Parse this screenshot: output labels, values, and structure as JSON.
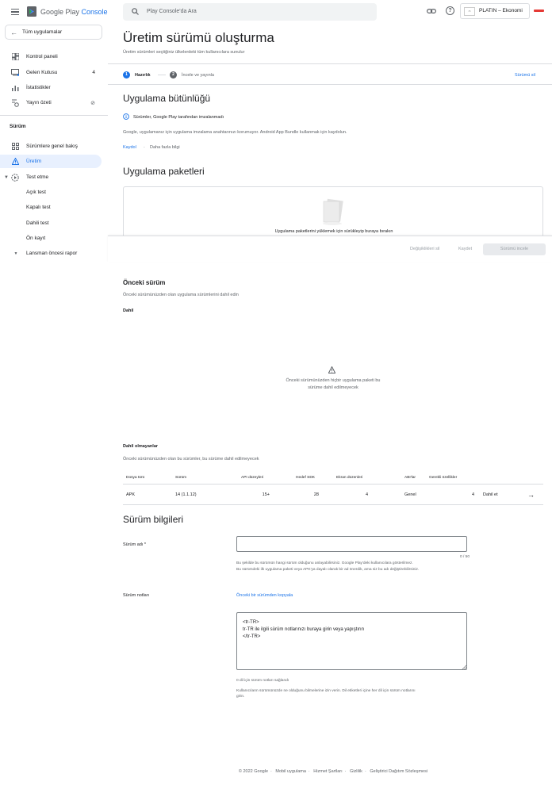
{
  "app": {
    "brand_google_play": "Google Play",
    "brand_console": "Console",
    "all_apps": "Tüm uygulamalar"
  },
  "sidebar": {
    "items": [
      {
        "label": "Kontrol paneli",
        "icon": "dashboard-icon"
      },
      {
        "label": "Gelen Kutusu",
        "icon": "inbox-icon",
        "count": "4"
      },
      {
        "label": "İstatistikler",
        "icon": "bar-chart-icon"
      },
      {
        "label": "Yayın özeti",
        "icon": "publishing-icon"
      }
    ],
    "section_title": "Sürüm",
    "release_items": [
      {
        "label": "Sürümlere genel bakış",
        "icon": "overview-icon"
      },
      {
        "label": "Üretim",
        "icon": "warning-icon",
        "active": true
      },
      {
        "label": "Test etme",
        "icon": "testing-icon"
      },
      {
        "label": "Açık test"
      },
      {
        "label": "Kapalı test"
      },
      {
        "label": "Dahili test"
      },
      {
        "label": "Ön kayıt"
      },
      {
        "label": "Lansman öncesi rapor"
      }
    ]
  },
  "topbar": {
    "search_placeholder": "Play Console'da Ara",
    "account_name": "PLATIN – Ekonomi"
  },
  "page": {
    "title": "Üretim sürümü oluşturma",
    "subtitle": "Üretim sürümleri seçtiğiniz ülkelerdeki tüm kullanıcılara sunulur",
    "steps": [
      {
        "num": "1",
        "label": "Hazırlık"
      },
      {
        "num": "2",
        "label": "İncele ve yayınla"
      }
    ],
    "delete_release": "Sürümü sil"
  },
  "integrity": {
    "title": "Uygulama bütünlüğü",
    "info": "Sürümler, Google Play tarafından imzalanmadı",
    "description": "Google, uygulamanız için uygulama imzalama anahtarınızı korumuyor. Android App Bundle kullanmak için kaydolun.",
    "enroll": "Kaydol",
    "learn_more": "Daha fazla bilgi"
  },
  "bundles": {
    "title": "Uygulama paketleri",
    "drop_text": "Uygulama paketlerini yüklemek için sürükleyip buraya bırakın"
  },
  "actions": {
    "discard": "Değişiklikleri sil",
    "save": "Kaydet",
    "review": "Sürümü incele"
  },
  "previous": {
    "title": "Önceki sürüm",
    "description": "Önceki sürümünüzden olan uygulama sürümlerini dahil edin",
    "included_label": "Dahil",
    "empty_line1": "Önceki sürümünüzden hiçbir uygulama paketi bu",
    "empty_line2": "sürüme dahil edilmeyecek",
    "not_included_label": "Dahil olmayanlar",
    "not_included_desc": "Önceki sürümünüzden olan bu sürümler, bu sürüme dahil edilmeyecek"
  },
  "table": {
    "headers": [
      "Dosya türü",
      "Sürüm",
      "API düzeyleri",
      "Hedef SDK",
      "Ekran düzenleri",
      "ABI'lar",
      "Gerekli özellikler"
    ],
    "row": [
      "APK",
      "14 (1.1.12)",
      "15+",
      "28",
      "4",
      "Genel",
      "4"
    ],
    "include_action": "Dahil et"
  },
  "release_info": {
    "title": "Sürüm bilgileri",
    "name_label": "Sürüm adı",
    "required_mark": "*",
    "char_count": "0 / 50",
    "name_help1": "Bu şekilde bu sürümün hangi sürüm olduğunu anlayabilirsiniz. Google Play'deki kullanıcılara gösterilmez.",
    "name_help2": "Bu sürümdeki ilk uygulama paketi veya APK'ya dayalı olarak bir ad önerdik, ama siz bu adı değiştirebilirsiniz.",
    "notes_label": "Sürüm notları",
    "copy_previous": "Önceki bir sürümden kopyala",
    "notes_text": "<tr-TR>\ntr-TR ile ilgili sürüm notlarınızı buraya girin veya yapıştırın\n</tr-TR>",
    "languages_count": "0 dil için sürüm notları sağlandı",
    "notes_help1": "Kullanıcıların sürümünüzde ne olduğunu bilmelerine izin verin. Dil etiketleri içine her dil için sürüm notlarını",
    "notes_help2": "girin."
  },
  "footer": {
    "links": [
      "© 2022 Google",
      "Mobil uygulama",
      "Hizmet Şartları",
      "Gizlilik",
      "Geliştirici Dağıtım Sözleşmesi"
    ]
  },
  "colors": {
    "accent": "#1a73e8",
    "active_bg": "#e8f0fe",
    "border": "#dadce0"
  }
}
